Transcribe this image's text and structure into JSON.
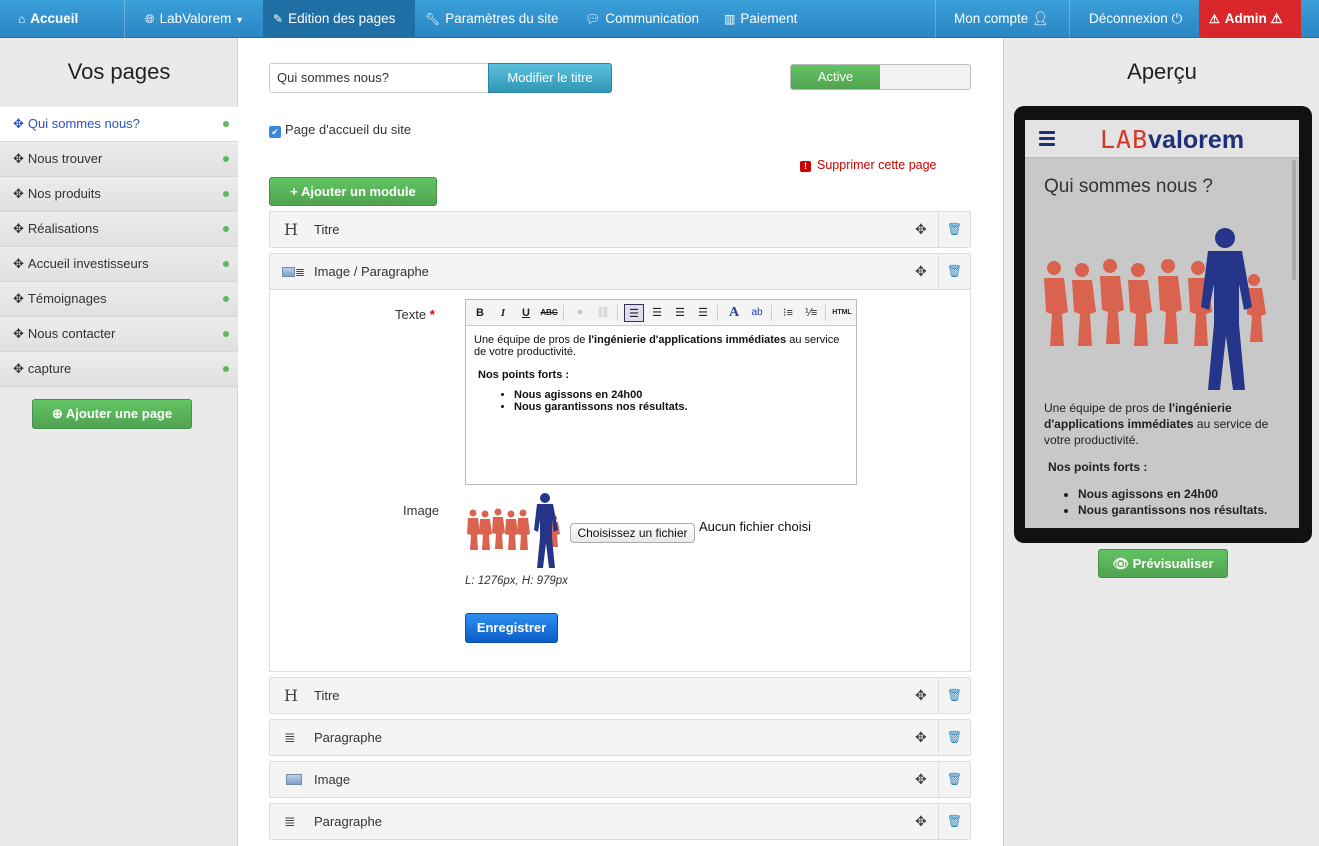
{
  "navbar": {
    "brand": "Accueil",
    "site": "LabValorem",
    "edit_pages": "Edition des pages",
    "settings": "Paramètres du site",
    "communication": "Communication",
    "payment": "Paiement",
    "account": "Mon compte",
    "logout": "Déconnexion",
    "admin": "Admin"
  },
  "sidebar": {
    "title": "Vos pages",
    "items": [
      {
        "label": "Qui sommes nous?"
      },
      {
        "label": "Nous trouver"
      },
      {
        "label": "Nos produits"
      },
      {
        "label": "Réalisations"
      },
      {
        "label": "Accueil investisseurs"
      },
      {
        "label": "Témoignages"
      },
      {
        "label": "Nous contacter"
      },
      {
        "label": "capture"
      }
    ],
    "add_page": "Ajouter une page"
  },
  "editor": {
    "title_value": "Qui sommes nous?",
    "rename_button": "Modifier le titre",
    "status_toggle": "Active",
    "homepage_checkbox": "Page d'accueil du site",
    "delete_page": "Supprimer cette page",
    "add_module": "Ajouter un module",
    "modules": [
      {
        "label": "Titre",
        "icon": "heading-icon"
      },
      {
        "label": "Image / Paragraphe",
        "icon": "image-paragraph-icon"
      },
      {
        "label": "Titre",
        "icon": "heading-icon"
      },
      {
        "label": "Paragraphe",
        "icon": "paragraph-icon"
      },
      {
        "label": "Image",
        "icon": "image-icon"
      },
      {
        "label": "Paragraphe",
        "icon": "paragraph-icon"
      }
    ],
    "text_label": "Texte",
    "required_mark": "*",
    "content": {
      "intro_before": "Une équipe de pros de ",
      "intro_bold": "l'ingénierie d'applications immédiates",
      "intro_after": " au service de votre productivité.",
      "strengths_title": "Nos points forts :",
      "bullets": [
        "Nous agissons en 24h00",
        "Nous garantissons nos résultats."
      ]
    },
    "image_label": "Image",
    "file_button": "Choisissez un fichier",
    "file_none": "Aucun fichier choisi",
    "image_dims": "L: 1276px, H: 979px",
    "save_button": "Enregistrer"
  },
  "preview": {
    "title": "Aperçu",
    "logo_lab": "LAB",
    "logo_valorem": "valorem",
    "page_title": "Qui sommes nous ?",
    "preview_button": "Prévisualiser"
  },
  "colors": {
    "navbar": "#2a86c4",
    "admin": "#d9262b",
    "green": "#5cb85c",
    "blue": "#0b5cc8",
    "danger": "#cc0000"
  }
}
